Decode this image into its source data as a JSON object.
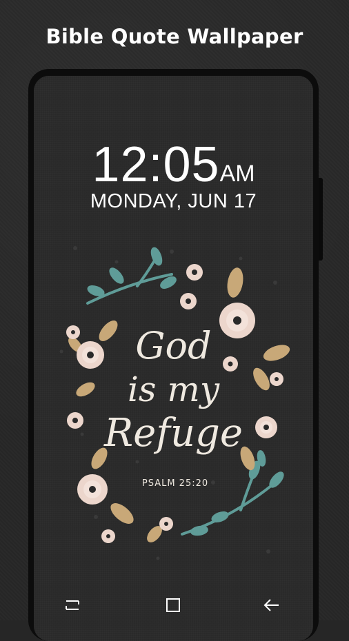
{
  "promo": {
    "title": "Bible Quote Wallpaper"
  },
  "lockscreen": {
    "time": "12:05",
    "ampm": "AM",
    "date": "MONDAY, JUN 17"
  },
  "wallpaper": {
    "quote_line1": "God",
    "quote_line2": "is my",
    "quote_line3": "Refuge",
    "reference": "PSALM 25:20",
    "colors": {
      "background": "#2b2b2b",
      "petal": "#ecd6cc",
      "leaf_gold": "#c8a878",
      "leaf_teal": "#5f9c98",
      "text": "#efe9e0"
    }
  },
  "navbar": {
    "recents_icon": "recents-icon",
    "home_icon": "home-icon",
    "back_icon": "back-icon"
  }
}
